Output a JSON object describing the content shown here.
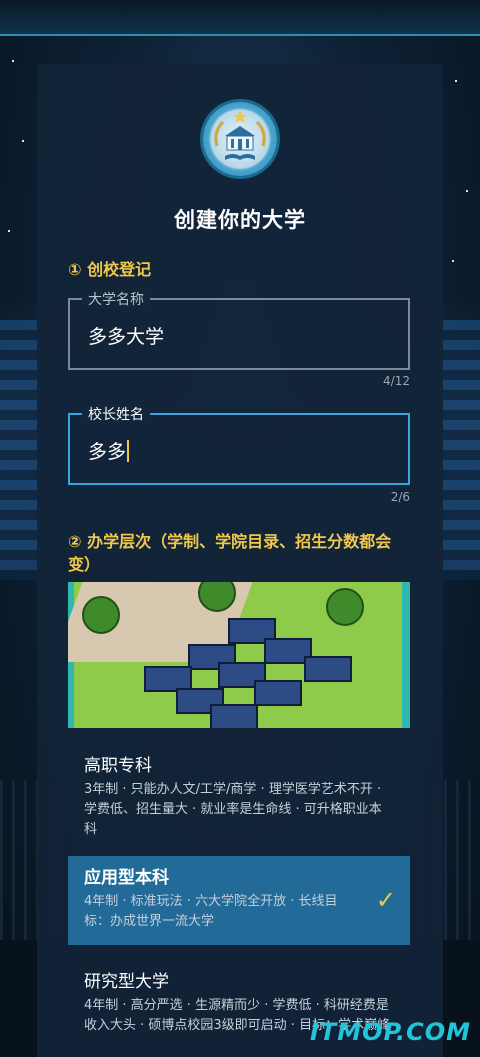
{
  "title": "创建你的大学",
  "section1": "① 创校登记",
  "university_field": {
    "label": "大学名称",
    "value": "多多大学",
    "counter": "4/12"
  },
  "president_field": {
    "label": "校长姓名",
    "value": "多多",
    "counter": "2/6"
  },
  "section2": "② 办学层次（学制、学院目录、招生分数都会变）",
  "options": [
    {
      "title": "高职专科",
      "desc": "3年制 · 只能办人文/工学/商学 · 理学医学艺术不开 · 学费低、招生量大 · 就业率是生命线 · 可升格职业本科"
    },
    {
      "title": "应用型本科",
      "desc": "4年制 · 标准玩法 · 六大学院全开放 · 长线目标：办成世界一流大学",
      "check": "✓"
    },
    {
      "title": "研究型大学",
      "desc": "4年制 · 高分严选 · 生源精而少 · 学费低 · 科研经费是收入大头 · 硕博点校园3级即可启动 · 目标：学术巅峰"
    }
  ],
  "watermark": "ITMOP.COM",
  "colors": {
    "accent": "#f2c84a",
    "selected": "#226a98",
    "active_border": "#3aa4dd"
  }
}
